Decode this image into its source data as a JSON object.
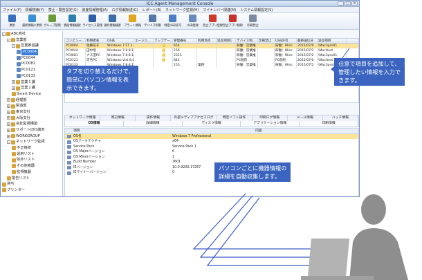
{
  "window": {
    "title": "ICC Agent Management Console",
    "controls": [
      "_",
      "□",
      "×"
    ]
  },
  "menu": [
    "ファイル(F)",
    "情報検索(Y)",
    "禁止・警告設定(G)",
    "資産情報管理(A)",
    "ログ情報転送(G)",
    "レポート(B)",
    "ネットワーク監視(M)",
    "マイナンバー関連(M)",
    "システム情報設定(S)"
  ],
  "toolbar": [
    {
      "label": "更新",
      "icon": "save-icon",
      "color": "#3a6fc0"
    },
    {
      "label": "最新情報に更新",
      "icon": "refresh-icon",
      "color": "#3b8ed8"
    },
    {
      "label": "グループ管理",
      "icon": "group-icon",
      "color": "#6a9a3a"
    },
    {
      "label": "資産情報検索",
      "icon": "asset-icon",
      "color": "#2f7fb0"
    },
    {
      "label": "ライセンス管理",
      "icon": "license-icon",
      "color": "#2e5fa8"
    },
    {
      "label": "操作情報検索",
      "icon": "search-icon",
      "color": "#3c6ea8"
    },
    {
      "label": "アラート情報",
      "icon": "alert-icon",
      "color": "#e0a81c"
    },
    {
      "label": "デバイス制御",
      "icon": "device-icon",
      "color": "#5577aa"
    },
    {
      "label": "特定USB許可",
      "icon": "usb-icon",
      "color": "#4a7fc8"
    },
    {
      "label": "USB登録",
      "icon": "usb-register-icon",
      "color": "#6a8abf"
    },
    {
      "label": "禁止アプリ登録",
      "icon": "ban-icon",
      "color": "#d03a2c"
    },
    {
      "label": "禁止アプリ削除",
      "icon": "delete-icon",
      "color": "#c8322a"
    },
    {
      "label": "印刷禁止",
      "icon": "printer-icon",
      "color": "#7a8aa0"
    }
  ],
  "tree": [
    {
      "label": "ABC商社",
      "indent": 0,
      "exp": "-"
    },
    {
      "label": "営業部",
      "indent": 1,
      "exp": "-"
    },
    {
      "label": "営業推進課",
      "indent": 2,
      "exp": "-"
    },
    {
      "label": "PC0004",
      "indent": 3,
      "exp": "",
      "selected": true
    },
    {
      "label": "PC0044",
      "indent": 3,
      "exp": ""
    },
    {
      "label": "PC0081",
      "indent": 3,
      "exp": ""
    },
    {
      "label": "PC0121",
      "indent": 3,
      "exp": ""
    },
    {
      "label": "PC0133",
      "indent": 3,
      "exp": ""
    },
    {
      "label": "営業１課",
      "indent": 2,
      "exp": "+"
    },
    {
      "label": "営業２課",
      "indent": 2,
      "exp": "+"
    },
    {
      "label": "Smart Device",
      "indent": 2,
      "exp": ""
    },
    {
      "label": "経理部",
      "indent": 1,
      "exp": "+"
    },
    {
      "label": "製造部",
      "indent": 1,
      "exp": "+"
    },
    {
      "label": "東京支社",
      "indent": 1,
      "exp": "+"
    },
    {
      "label": "大阪支社",
      "indent": 1,
      "exp": "+"
    },
    {
      "label": "会社監視構築",
      "indent": 1,
      "exp": "+"
    },
    {
      "label": "サポート切れ端末",
      "indent": 1,
      "exp": "+"
    },
    {
      "label": "WORKGROUP",
      "indent": 1,
      "exp": "+"
    },
    {
      "label": "ネットワーク監視",
      "indent": 1,
      "exp": "-"
    },
    {
      "label": "不正接続",
      "indent": 2,
      "exp": ""
    },
    {
      "label": "運用リスト",
      "indent": 2,
      "exp": ""
    },
    {
      "label": "除外リスト",
      "indent": 2,
      "exp": ""
    },
    {
      "label": "その他機器",
      "indent": 2,
      "exp": ""
    },
    {
      "label": "監視機器",
      "indent": 2,
      "exp": ""
    },
    {
      "label": "警告リスト",
      "indent": 1,
      "exp": ""
    },
    {
      "label": "貸与",
      "indent": 0,
      "exp": ""
    },
    {
      "label": "プリンター",
      "indent": 0,
      "exp": ""
    }
  ],
  "grid": {
    "columns": [
      "コンピュー...",
      "利用者名",
      "OS名",
      "エージェ...",
      "アップデー...",
      "管理番号",
      "利用地点",
      "追加項目1",
      "デバイス制...",
      "印刷禁止",
      "USB許可",
      "最終送信日",
      "追加項目"
    ],
    "rows": [
      {
        "cells": [
          "PC0004",
          "佐藤花子",
          "Windows 7 ET 3.8.1",
          "",
          "●",
          "654",
          "",
          "",
          "稼働：営業推",
          "",
          "稼働：Winc",
          "2015/07/0",
          "\\Mac3prn01"
        ],
        "selected": true
      },
      {
        "cells": [
          "PC0044",
          "田中悟",
          "Windows 7 8.8.1",
          "",
          "●",
          "156",
          "",
          "",
          "稼働：営業推",
          "",
          "稼働：Winc",
          "2015/07/2",
          "\\Mac\\test"
        ]
      },
      {
        "cells": [
          "PC0081",
          "ナス田PC",
          "Windows 7 8.8.1",
          "",
          "●",
          "2315",
          "",
          "",
          "稼働：営業推",
          "",
          "稼働：Winc",
          "2015/07/2",
          "\\Mac3prn01"
        ]
      },
      {
        "cells": [
          "PC0121",
          "可名PC",
          "Windows Vist 8.8.1",
          "",
          "●",
          "841",
          "",
          "",
          "PC個別",
          "",
          "PC個別",
          "2015/07/0",
          "\\Mac\\test"
        ]
      },
      {
        "cells": [
          "PC0133",
          "",
          "Windows 7 8.8.1",
          "",
          "",
          "155",
          "業務",
          "",
          "稼働：営業推",
          "",
          "稼働：Winc",
          "2015/07/2",
          "\\Mac3prn01"
        ]
      }
    ]
  },
  "tabs": {
    "row1": [
      "ネットワーク情報",
      "周辺情報",
      "操作情報",
      "外部メディアアクセスログ",
      "特定ソフト操作",
      "印刷ログ情報",
      "メール情報",
      "ハッチ情報"
    ],
    "row2": [
      "OS情報",
      "詳細情報",
      "ディスク情報",
      "アプリケーション情報",
      "印刷情報"
    ]
  },
  "detail": {
    "head_key": "項目",
    "head_val": "内容",
    "rows": [
      {
        "key": "OS名",
        "val": "Windows 7 Professional",
        "selected": true
      },
      {
        "key": "OSアーキテクチャ",
        "val": "x64"
      },
      {
        "key": "Service Pack",
        "val": "Service Pack 1"
      },
      {
        "key": "OS Majorバージョン",
        "val": "6"
      },
      {
        "key": "OS Minorバージョン",
        "val": "1"
      },
      {
        "key": "Build Number",
        "val": "7601"
      },
      {
        "key": "IEバージョン",
        "val": "10.0.9200.17267"
      },
      {
        "key": "IEマイナーバージョン",
        "val": "0"
      }
    ]
  },
  "callouts": {
    "tabs": [
      "タブを切り替えるだけで、",
      "簡単にパソコン情報を表",
      "示できます。"
    ],
    "fields": [
      "任意で項目を追加して、",
      "管理したい情報を入力で",
      "きます。"
    ],
    "collect": [
      "パソコンごとに機器情報の",
      "詳細を自動収集します。"
    ]
  }
}
